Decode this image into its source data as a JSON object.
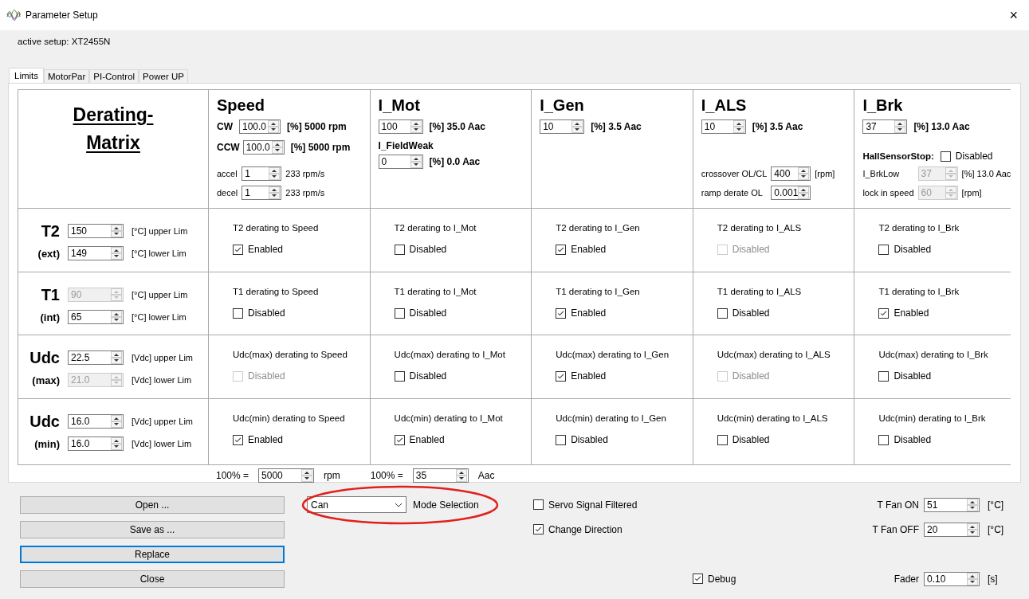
{
  "window": {
    "title": "Parameter Setup",
    "close": "×"
  },
  "active_setup": "active setup: XT2455N",
  "tabs": [
    {
      "label": "Limits",
      "selected": true
    },
    {
      "label": "MotorPar",
      "selected": false
    },
    {
      "label": "PI-Control",
      "selected": false
    },
    {
      "label": "Power UP",
      "selected": false
    }
  ],
  "matrix": {
    "title_lines": [
      "Derating-",
      "Matrix"
    ],
    "columns": [
      {
        "heading": "Speed",
        "lines": [
          {
            "kind": "bold_spin",
            "label": "CW",
            "value": "100.0",
            "unit": "[%] 5000 rpm"
          },
          {
            "kind": "bold_spin",
            "label": "CCW",
            "value": "100.0",
            "unit": "[%] 5000 rpm"
          },
          {
            "kind": "small_spin",
            "label": "accel",
            "value": "1",
            "disabled": false,
            "unit": "233 rpm/s"
          },
          {
            "kind": "small_spin",
            "label": "decel",
            "value": "1",
            "disabled": false,
            "unit": "233 rpm/s"
          }
        ]
      },
      {
        "heading": "I_Mot",
        "lines": [
          {
            "kind": "bold_spin",
            "value": "100",
            "unit": "[%] 35.0 Aac"
          },
          {
            "kind": "subhead",
            "label": "I_FieldWeak"
          },
          {
            "kind": "bold_spin",
            "value": "0",
            "unit": "[%] 0.0 Aac"
          }
        ]
      },
      {
        "heading": "I_Gen",
        "lines": [
          {
            "kind": "bold_spin",
            "value": "10",
            "unit": "[%] 3.5 Aac"
          }
        ]
      },
      {
        "heading": "I_ALS",
        "lines": [
          {
            "kind": "bold_spin",
            "value": "10",
            "unit": "[%] 3.5 Aac"
          },
          {
            "kind": "small_spin",
            "label": "crossover OL/CL",
            "value": "400",
            "disabled": false,
            "unit": "[rpm]"
          },
          {
            "kind": "small_spin",
            "label": "ramp derate OL",
            "value": "0.001",
            "disabled": false
          }
        ]
      },
      {
        "heading": "I_Brk",
        "lines": [
          {
            "kind": "bold_spin",
            "value": "37",
            "unit": "[%] 13.0 Aac"
          },
          {
            "kind": "check",
            "label": "HallSensorStop:",
            "checked": false,
            "text": "Disabled"
          },
          {
            "kind": "small_spin",
            "label": "I_BrkLow",
            "value": "37",
            "disabled": true,
            "unit": "[%] 13.0 Aac"
          },
          {
            "kind": "small_spin",
            "label": "lock in speed",
            "value": "60",
            "disabled": true,
            "unit": "[rpm]"
          }
        ]
      }
    ],
    "rows": [
      {
        "name": "T2",
        "sub": "(ext)",
        "limits": [
          {
            "value": "150",
            "disabled": false,
            "label": "[°C] upper Lim"
          },
          {
            "value": "149",
            "disabled": false,
            "label": "[°C] lower Lim"
          }
        ],
        "cells": [
          {
            "caption": "T2 derating to Speed",
            "checked": true,
            "disabled": false,
            "text": "Enabled"
          },
          {
            "caption": "T2 derating to I_Mot",
            "checked": false,
            "disabled": false,
            "text": "Disabled"
          },
          {
            "caption": "T2 derating to I_Gen",
            "checked": true,
            "disabled": false,
            "text": "Enabled"
          },
          {
            "caption": "T2 derating to I_ALS",
            "checked": false,
            "disabled": true,
            "text": "Disabled"
          },
          {
            "caption": "T2 derating to I_Brk",
            "checked": false,
            "disabled": false,
            "text": "Disabled"
          }
        ]
      },
      {
        "name": "T1",
        "sub": "(int)",
        "limits": [
          {
            "value": "90",
            "disabled": true,
            "label": "[°C] upper Lim"
          },
          {
            "value": "65",
            "disabled": false,
            "label": "[°C] lower Lim"
          }
        ],
        "cells": [
          {
            "caption": "T1 derating to Speed",
            "checked": false,
            "disabled": false,
            "text": "Disabled"
          },
          {
            "caption": "T1 derating to I_Mot",
            "checked": false,
            "disabled": false,
            "text": "Disabled"
          },
          {
            "caption": "T1 derating to I_Gen",
            "checked": true,
            "disabled": false,
            "text": "Enabled"
          },
          {
            "caption": "T1 derating to I_ALS",
            "checked": false,
            "disabled": false,
            "text": "Disabled"
          },
          {
            "caption": "T1 derating to I_Brk",
            "checked": true,
            "disabled": false,
            "text": "Enabled"
          }
        ]
      },
      {
        "name": "Udc",
        "sub": "(max)",
        "limits": [
          {
            "value": "22.5",
            "disabled": false,
            "label": "[Vdc] upper Lim"
          },
          {
            "value": "21.0",
            "disabled": true,
            "label": "[Vdc] lower Lim"
          }
        ],
        "cells": [
          {
            "caption": "Udc(max) derating to Speed",
            "checked": false,
            "disabled": true,
            "text": "Disabled"
          },
          {
            "caption": "Udc(max) derating to I_Mot",
            "checked": false,
            "disabled": false,
            "text": "Disabled"
          },
          {
            "caption": "Udc(max) derating to I_Gen",
            "checked": true,
            "disabled": false,
            "text": "Enabled"
          },
          {
            "caption": "Udc(max) derating to I_ALS",
            "checked": false,
            "disabled": true,
            "text": "Disabled"
          },
          {
            "caption": "Udc(max) derating to I_Brk",
            "checked": false,
            "disabled": false,
            "text": "Disabled"
          }
        ]
      },
      {
        "name": "Udc",
        "sub": "(min)",
        "limits": [
          {
            "value": "16.0",
            "disabled": false,
            "label": "[Vdc] upper Lim"
          },
          {
            "value": "16.0",
            "disabled": false,
            "label": "[Vdc] lower Lim"
          }
        ],
        "cells": [
          {
            "caption": "Udc(min) derating to Speed",
            "checked": true,
            "disabled": false,
            "text": "Enabled"
          },
          {
            "caption": "Udc(min) derating to I_Mot",
            "checked": true,
            "disabled": false,
            "text": "Enabled"
          },
          {
            "caption": "Udc(min) derating to I_Gen",
            "checked": false,
            "disabled": false,
            "text": "Disabled"
          },
          {
            "caption": "Udc(min) derating to I_ALS",
            "checked": false,
            "disabled": false,
            "text": "Disabled"
          },
          {
            "caption": "Udc(min) derating to I_Brk",
            "checked": false,
            "disabled": false,
            "text": "Disabled"
          }
        ]
      }
    ]
  },
  "scales": [
    {
      "prefix": "100% =",
      "value": "5000",
      "unit": "rpm"
    },
    {
      "prefix": "100% =",
      "value": "35",
      "unit": "Aac"
    }
  ],
  "buttons": [
    {
      "label": "Open ...",
      "focused": false
    },
    {
      "label": "Save as ...",
      "focused": false
    },
    {
      "label": "Replace",
      "focused": true
    },
    {
      "label": "Close",
      "focused": false
    }
  ],
  "mode": {
    "value": "Can",
    "label": "Mode Selection",
    "highlighted": true
  },
  "options": [
    {
      "label": "Servo Signal Filtered",
      "checked": false
    },
    {
      "label": "Change Direction",
      "checked": true
    }
  ],
  "debug": {
    "label": "Debug",
    "checked": true
  },
  "fans": [
    {
      "label": "T Fan ON",
      "value": "51",
      "unit": "[°C]"
    },
    {
      "label": "T Fan OFF",
      "value": "20",
      "unit": "[°C]"
    }
  ],
  "fader": {
    "label": "Fader",
    "value": "0.10",
    "unit": "[s]"
  }
}
